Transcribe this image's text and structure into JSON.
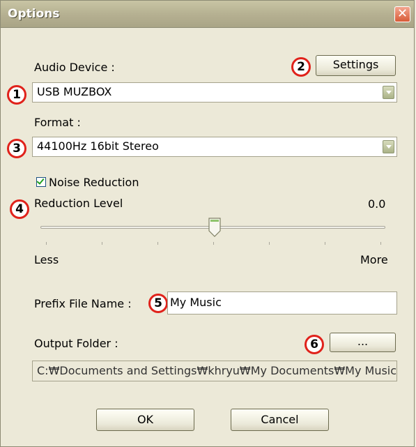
{
  "window": {
    "title": "Options",
    "close_label": "✕"
  },
  "audio_device": {
    "label": "Audio Device :",
    "value": "USB MUZBOX",
    "settings_button": "Settings"
  },
  "format": {
    "label": "Format :",
    "value": "44100Hz  16bit  Stereo"
  },
  "noise_reduction": {
    "checkbox_label": "Noise Reduction",
    "checked": true
  },
  "reduction_level": {
    "label": "Reduction Level",
    "value_text": "0.0",
    "slider_fraction": 0.5,
    "min_label": "Less",
    "max_label": "More"
  },
  "prefix": {
    "label": "Prefix File Name :",
    "value": "My Music"
  },
  "output_folder": {
    "label": "Output Folder :",
    "browse_button": "...",
    "path": "C:₩Documents and Settings₩khryu₩My Documents₩My Music"
  },
  "buttons": {
    "ok": "OK",
    "cancel": "Cancel"
  },
  "badges": [
    "1",
    "2",
    "3",
    "4",
    "5",
    "6"
  ],
  "colors": {
    "badge_ring": "#e0221b",
    "titlebar": "#b6b192",
    "close": "#d85a37"
  }
}
